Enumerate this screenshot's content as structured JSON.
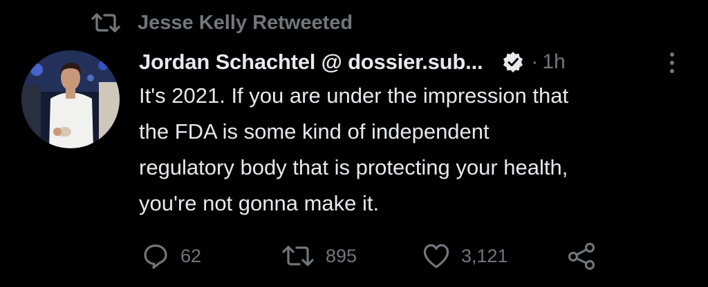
{
  "retweet_context": {
    "icon": "retweet-icon",
    "text": "Jesse Kelly Retweeted"
  },
  "author": {
    "display_name": "Jordan Schachtel @ dossier.sub...",
    "verified": true,
    "verified_icon": "verified-badge-icon"
  },
  "meta": {
    "separator": "·",
    "time": "1h",
    "more_icon": "more-vertical-icon"
  },
  "tweet": {
    "lines": [
      "It's 2021. If you are under the impression that",
      "the FDA is some kind of independent",
      "regulatory body that is protecting your health,",
      "you're not gonna make it."
    ]
  },
  "actions": {
    "reply": {
      "icon": "reply-icon",
      "count": "62"
    },
    "retweet": {
      "icon": "retweet-icon",
      "count": "895"
    },
    "like": {
      "icon": "heart-icon",
      "count": "3,121"
    },
    "share": {
      "icon": "share-icon"
    }
  },
  "colors": {
    "background": "#000000",
    "primary_text": "#e7e9ea",
    "secondary_text": "#71767b"
  }
}
